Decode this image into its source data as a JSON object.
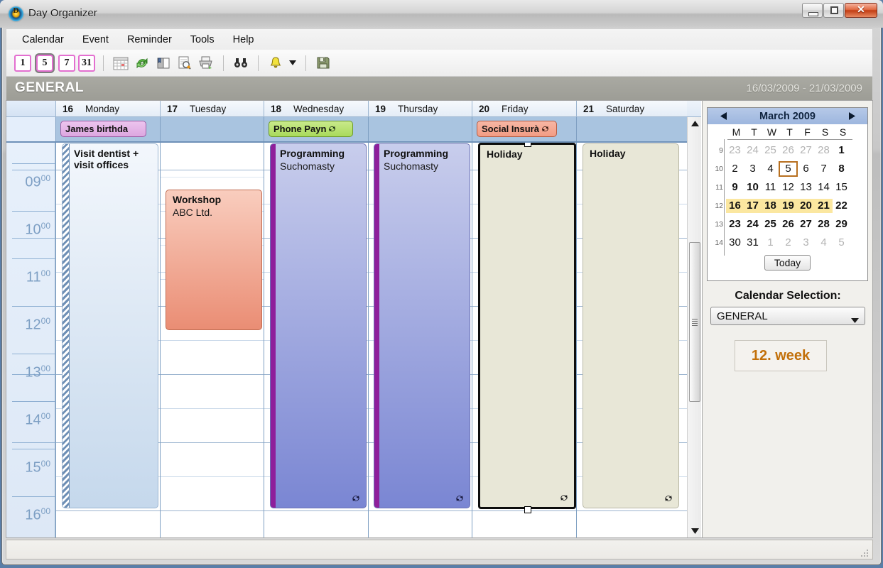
{
  "window": {
    "title": "Day Organizer",
    "icon_letter": "D",
    "buttons": {
      "minimize": "–",
      "maximize": "□",
      "close": "✕"
    }
  },
  "menu": {
    "items": [
      "Calendar",
      "Event",
      "Reminder",
      "Tools",
      "Help"
    ]
  },
  "toolbar": {
    "views": [
      {
        "label": "1",
        "name": "day-view-button",
        "selected": false
      },
      {
        "label": "5",
        "name": "workweek-view-button",
        "selected": true
      },
      {
        "label": "7",
        "name": "week-view-button",
        "selected": false
      },
      {
        "label": "31",
        "name": "month-view-button",
        "selected": false
      }
    ],
    "icons": [
      "calendar-grid-icon",
      "refresh-icon",
      "address-book-icon",
      "print-preview-icon",
      "print-icon",
      "find-icon",
      "reminder-bell-icon",
      "dropdown-caret-icon",
      "save-icon"
    ]
  },
  "header": {
    "calendar_name": "GENERAL",
    "date_range": "16/03/2009 - 21/03/2009"
  },
  "days": [
    {
      "num": "16",
      "name": "Monday"
    },
    {
      "num": "17",
      "name": "Tuesday"
    },
    {
      "num": "18",
      "name": "Wednesday"
    },
    {
      "num": "19",
      "name": "Thursday"
    },
    {
      "num": "20",
      "name": "Friday"
    },
    {
      "num": "21",
      "name": "Saturday"
    }
  ],
  "allday_events": [
    {
      "day": 0,
      "text": "James birthda",
      "color": "#dda7e0",
      "style": "pink",
      "recurring": false
    },
    {
      "day": 2,
      "text": "Phone Payn",
      "color": "#a9da5b",
      "style": "green",
      "recurring": true
    },
    {
      "day": 4,
      "text": "Social Insurà",
      "color": "#f29c84",
      "style": "red",
      "recurring": true
    }
  ],
  "time_labels": [
    {
      "hour": "09",
      "min": "00"
    },
    {
      "hour": "10",
      "min": "00"
    },
    {
      "hour": "11",
      "min": "00"
    },
    {
      "hour": "12",
      "min": "00"
    },
    {
      "hour": "13",
      "min": "00"
    },
    {
      "hour": "14",
      "min": "00"
    },
    {
      "hour": "15",
      "min": "00"
    },
    {
      "hour": "16",
      "min": "00"
    }
  ],
  "events": [
    {
      "title": "Visit dentist +",
      "title2": "visit offices",
      "subtitle": "",
      "day": 0,
      "kind": "dentist",
      "recurring": false,
      "selected": false
    },
    {
      "title": "Workshop",
      "subtitle": "ABC Ltd.",
      "day": 1,
      "kind": "workshop",
      "recurring": false,
      "selected": false
    },
    {
      "title": "Programming",
      "subtitle": "Suchomasty",
      "day": 2,
      "kind": "programming",
      "recurring": true,
      "selected": false
    },
    {
      "title": "Programming",
      "subtitle": "Suchomasty",
      "day": 3,
      "kind": "programming",
      "recurring": true,
      "selected": false
    },
    {
      "title": "Holiday",
      "subtitle": "",
      "day": 4,
      "kind": "holiday",
      "recurring": true,
      "selected": true
    },
    {
      "title": "Holiday",
      "subtitle": "",
      "day": 5,
      "kind": "holiday",
      "recurring": true,
      "selected": false
    }
  ],
  "minicalendar": {
    "month_title": "March 2009",
    "prev_label": "◀",
    "next_label": "▶",
    "dow": [
      "M",
      "T",
      "W",
      "T",
      "F",
      "S",
      "S"
    ],
    "weeks": [
      {
        "wk": "9",
        "days": [
          {
            "d": "23",
            "o": true
          },
          {
            "d": "24",
            "o": true
          },
          {
            "d": "25",
            "o": true
          },
          {
            "d": "26",
            "o": true
          },
          {
            "d": "27",
            "o": true
          },
          {
            "d": "28",
            "o": true
          },
          {
            "d": "1",
            "b": true
          }
        ]
      },
      {
        "wk": "10",
        "days": [
          {
            "d": "2"
          },
          {
            "d": "3"
          },
          {
            "d": "4"
          },
          {
            "d": "5",
            "today": true
          },
          {
            "d": "6"
          },
          {
            "d": "7"
          },
          {
            "d": "8",
            "b": true
          }
        ]
      },
      {
        "wk": "11",
        "days": [
          {
            "d": "9",
            "b": true
          },
          {
            "d": "10",
            "b": true
          },
          {
            "d": "11"
          },
          {
            "d": "12"
          },
          {
            "d": "13"
          },
          {
            "d": "14"
          },
          {
            "d": "15"
          }
        ]
      },
      {
        "wk": "12",
        "days": [
          {
            "d": "16",
            "b": true,
            "h": true
          },
          {
            "d": "17",
            "b": true,
            "h": true
          },
          {
            "d": "18",
            "b": true,
            "h": true
          },
          {
            "d": "19",
            "b": true,
            "h": true
          },
          {
            "d": "20",
            "b": true,
            "h": true
          },
          {
            "d": "21",
            "b": true,
            "h": true
          },
          {
            "d": "22",
            "b": true
          }
        ]
      },
      {
        "wk": "13",
        "days": [
          {
            "d": "23",
            "b": true
          },
          {
            "d": "24",
            "b": true
          },
          {
            "d": "25",
            "b": true
          },
          {
            "d": "26",
            "b": true
          },
          {
            "d": "27",
            "b": true
          },
          {
            "d": "28",
            "b": true
          },
          {
            "d": "29",
            "b": true
          }
        ]
      },
      {
        "wk": "14",
        "days": [
          {
            "d": "30"
          },
          {
            "d": "31"
          },
          {
            "d": "1",
            "o": true
          },
          {
            "d": "2",
            "o": true
          },
          {
            "d": "3",
            "o": true
          },
          {
            "d": "4",
            "o": true
          },
          {
            "d": "5",
            "o": true
          }
        ]
      }
    ],
    "today_button": "Today"
  },
  "sidebar": {
    "calendar_selection_label": "Calendar Selection:",
    "calendar_selected": "GENERAL",
    "week_number": "12. week"
  },
  "colors": {
    "highlight_week": "#fbe7a0",
    "today_outline": "#b8701f",
    "week_text": "#c2700a",
    "allday_row": "#a9c4e0",
    "header_bar": "#a9a9a2"
  }
}
